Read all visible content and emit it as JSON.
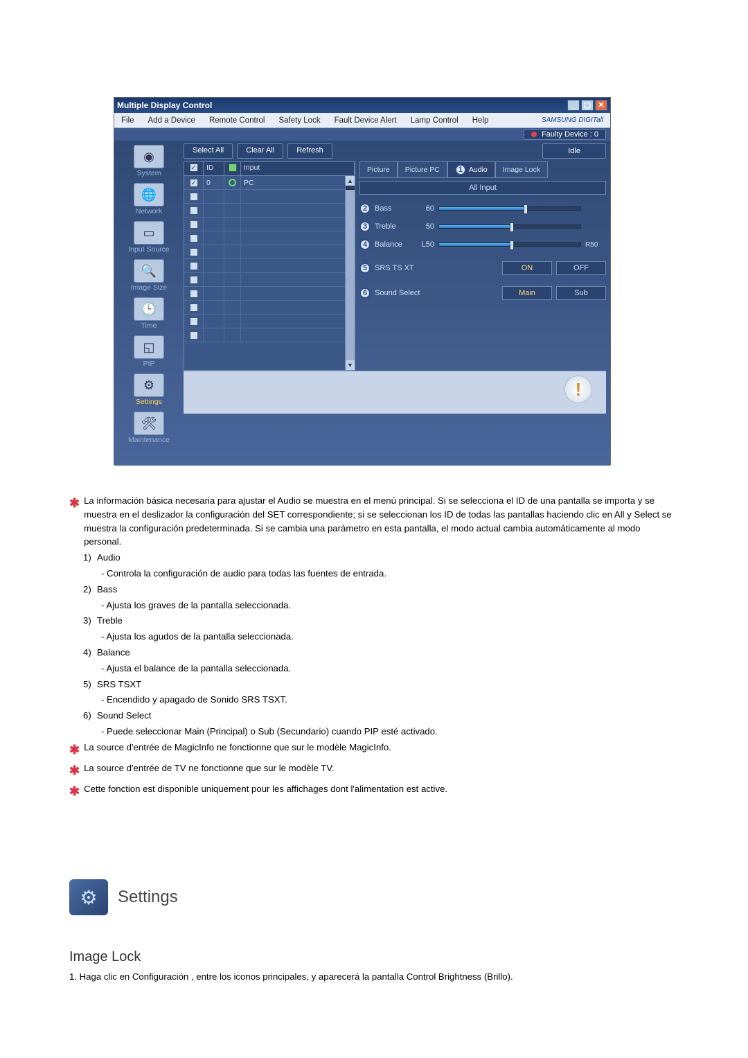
{
  "app": {
    "title": "Multiple Display Control",
    "menu": [
      "File",
      "Add a Device",
      "Remote Control",
      "Safety Lock",
      "Fault Device Alert",
      "Lamp Control",
      "Help"
    ],
    "brand": "SAMSUNG DIGITall",
    "faulty_label": "Faulty Device : 0",
    "toolbar": {
      "select_all": "Select All",
      "clear_all": "Clear All",
      "refresh": "Refresh",
      "status": "Idle"
    },
    "sidebar": [
      {
        "label": "System"
      },
      {
        "label": "Network"
      },
      {
        "label": "Input Source"
      },
      {
        "label": "Image Size"
      },
      {
        "label": "Time"
      },
      {
        "label": "PIP"
      },
      {
        "label": "Settings"
      },
      {
        "label": "Maintenance"
      }
    ],
    "grid": {
      "headers": {
        "chk": "",
        "id": "ID",
        "status": "",
        "input": "Input"
      },
      "rows": [
        {
          "id": "0",
          "input": "PC"
        }
      ],
      "blank_rows": 11
    },
    "tabs": [
      {
        "label": "Picture"
      },
      {
        "label": "Picture PC"
      },
      {
        "label": "Audio",
        "marker": "1"
      },
      {
        "label": "Image Lock"
      }
    ],
    "all_input": "All Input",
    "sliders": [
      {
        "marker": "2",
        "label": "Bass",
        "lval": "60",
        "pct": 60
      },
      {
        "marker": "3",
        "label": "Treble",
        "lval": "50",
        "pct": 50
      },
      {
        "marker": "4",
        "label": "Balance",
        "lval": "L50",
        "rval": "R50",
        "pct": 50
      }
    ],
    "toggles": [
      {
        "marker": "5",
        "label": "SRS TS XT",
        "on": "ON",
        "off": "OFF"
      },
      {
        "marker": "6",
        "label": "Sound Select",
        "on": "Main",
        "off": "Sub"
      }
    ]
  },
  "doc": {
    "bullet_star": "La información básica necesaria para ajustar el Audio se muestra en el menú principal. Si se selecciona el ID de una pantalla se importa y se muestra en el deslizador la configuración del SET correspondiente; si se seleccionan los ID de todas las pantallas haciendo clic en All y Select se muestra la configuración predeterminada. Si se cambia una parámetro en esta pantalla, el modo actual cambia automáticamente al modo personal.",
    "items": [
      {
        "n": "1)",
        "title": "Audio",
        "desc": "- Controla la configuración de audio para todas las fuentes de entrada."
      },
      {
        "n": "2)",
        "title": "Bass",
        "desc": "- Ajusta los graves de la pantalla seleccionada."
      },
      {
        "n": "3)",
        "title": "Treble",
        "desc": "- Ajusta los agudos de la pantalla seleccionada."
      },
      {
        "n": "4)",
        "title": "Balance",
        "desc": "- Ajusta el balance de la pantalla seleccionada."
      },
      {
        "n": "5)",
        "title": "SRS TSXT",
        "desc": "- Encendido y apagado de Sonido SRS TSXT."
      },
      {
        "n": "6)",
        "title": "Sound Select",
        "desc": "- Puede seleccionar Main (Principal) o Sub (Secundario) cuando PIP esté activado."
      }
    ],
    "notes_star": [
      "La source d'entrée de MagicInfo ne fonctionne que sur le modèle MagicInfo.",
      "La source d'entrée de TV ne fonctionne que sur le modèle TV.",
      "Cette fonction est disponible uniquement pour les affichages dont l'alimentation est active."
    ]
  },
  "settings": {
    "heading": "Settings"
  },
  "imagelock": {
    "heading": "Image Lock",
    "step": "1.  Haga clic en Configuración , entre los iconos principales, y aparecerá la pantalla Control Brightness (Brillo)."
  }
}
